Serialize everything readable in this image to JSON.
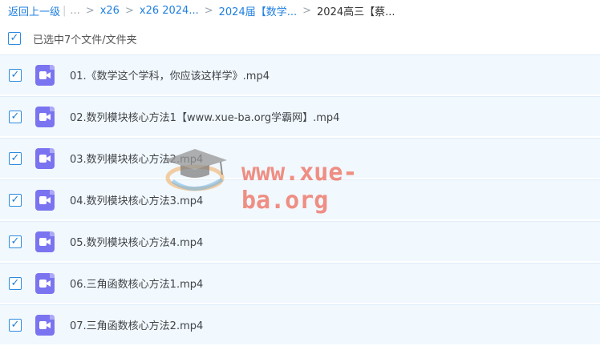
{
  "breadcrumb": {
    "back": "返回上一级",
    "bar": "|",
    "ellipsis": "...",
    "separator": ">",
    "items": [
      "x26",
      "x26 2024...",
      "2024届【数学..."
    ],
    "current": "2024高三【蔡..."
  },
  "selection": {
    "label": "已选中7个文件/文件夹",
    "checked": true
  },
  "files": [
    {
      "name": "01.《数学这个学科，你应该这样学》.mp4",
      "checked": true,
      "icon": "video-file-icon"
    },
    {
      "name": "02.数列模块核心方法1【www.xue-ba.org学霸网】.mp4",
      "checked": true,
      "icon": "video-file-icon"
    },
    {
      "name": "03.数列模块核心方法2.mp4",
      "checked": true,
      "icon": "video-file-icon"
    },
    {
      "name": "04.数列模块核心方法3.mp4",
      "checked": true,
      "icon": "video-file-icon"
    },
    {
      "name": "05.数列模块核心方法4.mp4",
      "checked": true,
      "icon": "video-file-icon"
    },
    {
      "name": "06.三角函数核心方法1.mp4",
      "checked": true,
      "icon": "video-file-icon"
    },
    {
      "name": "07.三角函数核心方法2.mp4",
      "checked": true,
      "icon": "video-file-icon"
    }
  ],
  "watermark": {
    "text": "www.xue-ba.org",
    "icon": "graduation-cap-icon"
  },
  "colors": {
    "link": "#1f7fe0",
    "row_background": "#f1f8fe",
    "checkbox": "#2b8ae0",
    "video_icon": "#7b74f0",
    "watermark": "#ee7060"
  }
}
